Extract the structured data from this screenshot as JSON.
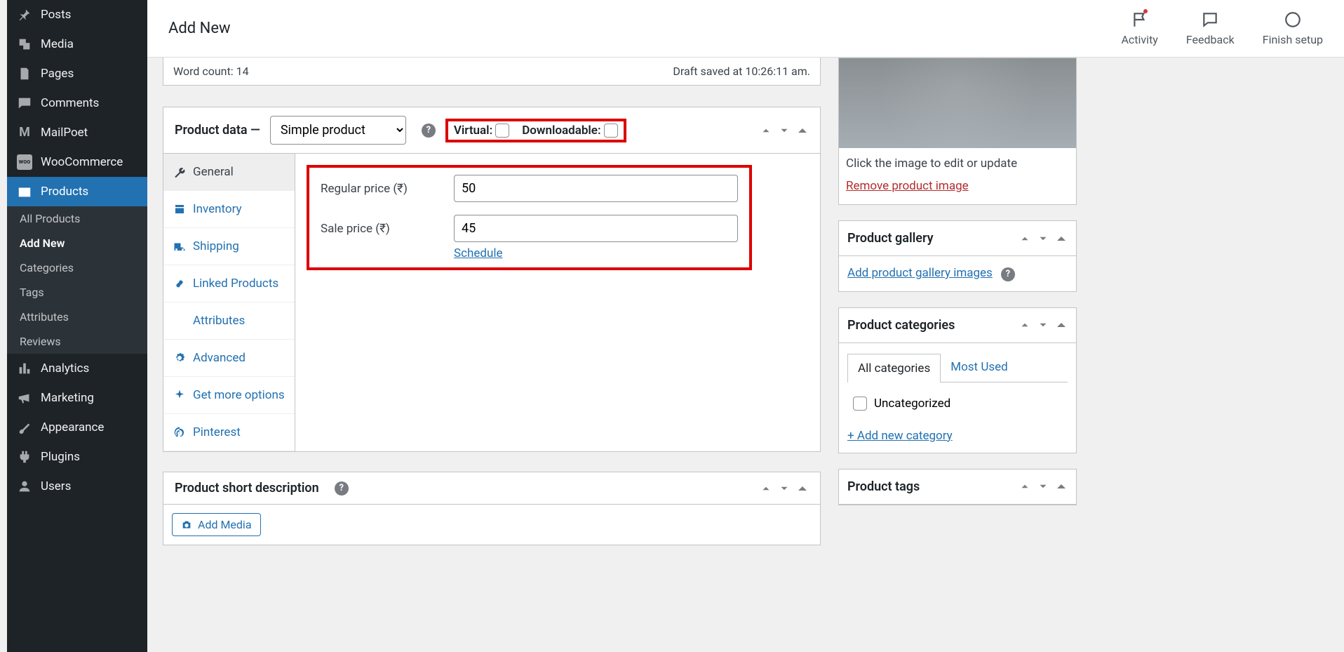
{
  "topbar": {
    "title": "Add New",
    "activity": "Activity",
    "feedback": "Feedback",
    "finish": "Finish setup"
  },
  "sidebar": {
    "items": [
      {
        "label": "Posts"
      },
      {
        "label": "Media"
      },
      {
        "label": "Pages"
      },
      {
        "label": "Comments"
      },
      {
        "label": "MailPoet"
      },
      {
        "label": "WooCommerce"
      },
      {
        "label": "Products"
      },
      {
        "label": "Analytics"
      },
      {
        "label": "Marketing"
      },
      {
        "label": "Appearance"
      },
      {
        "label": "Plugins"
      },
      {
        "label": "Users"
      }
    ],
    "sub": [
      "All Products",
      "Add New",
      "Categories",
      "Tags",
      "Attributes",
      "Reviews"
    ]
  },
  "editor": {
    "wordcount": "Word count: 14",
    "draftsaved": "Draft saved at 10:26:11 am."
  },
  "pdata": {
    "title": "Product data —",
    "type": "Simple product",
    "virtual": "Virtual:",
    "downloadable": "Downloadable:",
    "tabs": [
      "General",
      "Inventory",
      "Shipping",
      "Linked Products",
      "Attributes",
      "Advanced",
      "Get more options",
      "Pinterest"
    ],
    "regular_label": "Regular price (₹)",
    "regular_value": "50",
    "sale_label": "Sale price (₹)",
    "sale_value": "45",
    "schedule": "Schedule"
  },
  "shortdesc": {
    "title": "Product short description",
    "addmedia": "Add Media"
  },
  "image": {
    "caption": "Click the image to edit or update",
    "remove": "Remove product image"
  },
  "gallery": {
    "title": "Product gallery",
    "add": "Add product gallery images"
  },
  "cats": {
    "title": "Product categories",
    "all": "All categories",
    "most": "Most Used",
    "uncat": "Uncategorized",
    "add": "+ Add new category"
  },
  "tags": {
    "title": "Product tags"
  }
}
